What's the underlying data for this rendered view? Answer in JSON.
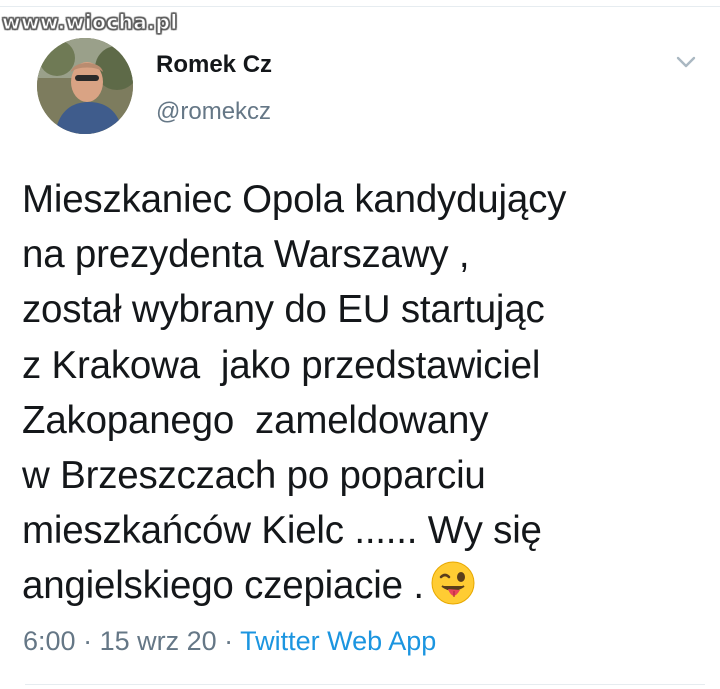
{
  "watermark": "www.wiocha.pl",
  "author": {
    "name": "Romek Cz",
    "handle": "@romekcz",
    "avatar_icon": "profile-photo"
  },
  "tweet": {
    "lines": [
      "Mieszkaniec Opola kandydujący",
      "na prezydenta Warszawy ,",
      "został wybrany do EU startując",
      "z Krakowa  jako przedstawiciel",
      "Zakopanego  zameldowany",
      "w Brzeszczach po poparciu",
      "mieszkańców Kielc ...... Wy się",
      "angielskiego czepiacie ."
    ],
    "emoji": "winking-face-with-tongue",
    "time": "6:00",
    "separator": " · ",
    "date": "15 wrz 20",
    "source": "Twitter Web App"
  },
  "menu_icon": "chevron-down-icon",
  "colors": {
    "text": "#14171a",
    "secondary": "#657786",
    "link": "#1b95e0",
    "divider": "#e6ecf0"
  }
}
